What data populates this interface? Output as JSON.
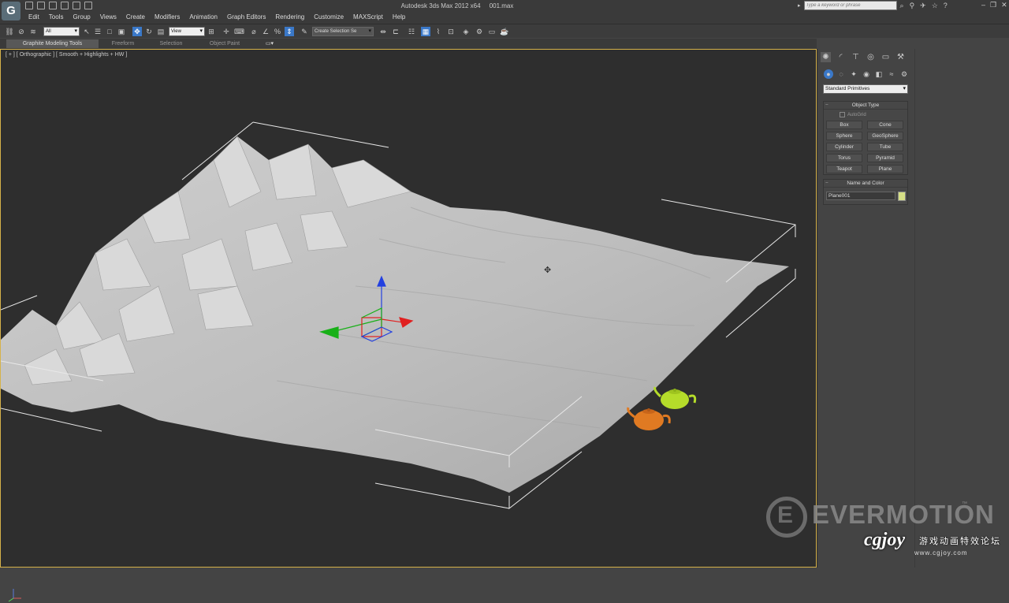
{
  "title_bar": {
    "app_title": "Autodesk 3ds Max  2012 x64",
    "file_name": "001.max",
    "search_placeholder": "Type a keyword or phrase",
    "logo_letter": "G"
  },
  "menu": [
    "Edit",
    "Tools",
    "Group",
    "Views",
    "Create",
    "Modifiers",
    "Animation",
    "Graph Editors",
    "Rendering",
    "Customize",
    "MAXScript",
    "Help"
  ],
  "toolbar": {
    "selection_filter": "All",
    "reference_coord": "View",
    "named_selection_placeholder": "Create Selection Se"
  },
  "ribbon": {
    "tabs": [
      "Graphite Modeling Tools",
      "Freeform",
      "Selection",
      "Object Paint"
    ],
    "active_tab": "Graphite Modeling Tools"
  },
  "viewport": {
    "label": "[ + ] [ Orthographic ] [ Smooth + Highlights + HW ]",
    "border_color": "#d6b24a",
    "teapot_colors": [
      "#e07a22",
      "#b5dc2a"
    ]
  },
  "command_panel": {
    "dropdown_value": "Standard Primitives",
    "object_type": {
      "header": "Object Type",
      "autogrid": "AutoGrid",
      "buttons": [
        "Box",
        "Cone",
        "Sphere",
        "GeoSphere",
        "Cylinder",
        "Tube",
        "Torus",
        "Pyramid",
        "Teapot",
        "Plane"
      ]
    },
    "name_and_color": {
      "header": "Name and Color",
      "name_value": "Plane001",
      "color": "#d6df86"
    }
  },
  "watermarks": {
    "evermotion": "EVERMOTION",
    "evermotion_tm": "™",
    "cgjoy": "cgjoy",
    "cgjoy_cn": "游戏动画特效论坛",
    "cgjoy_url": "www.cgjoy.com"
  }
}
